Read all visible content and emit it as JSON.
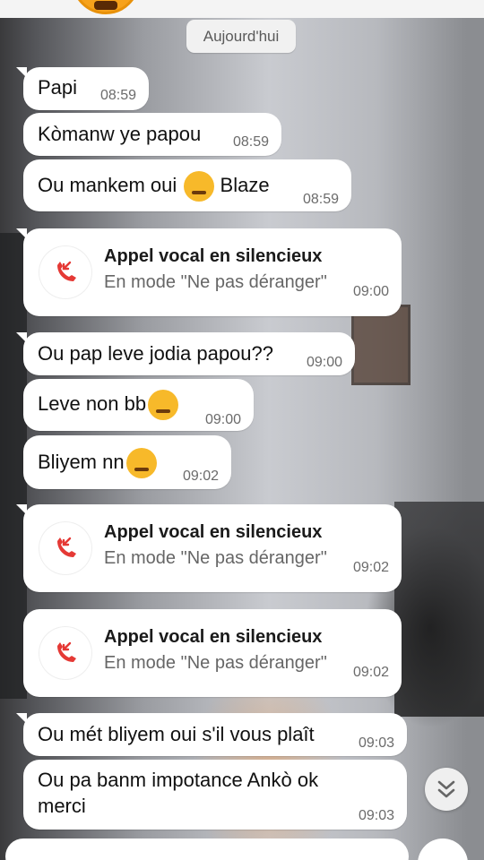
{
  "date_separator": "Aujourd'hui",
  "messages": [
    {
      "type": "text",
      "text": "Papi",
      "time": "08:59"
    },
    {
      "type": "text",
      "text": "Kòmanw ye papou",
      "time": "08:59"
    },
    {
      "type": "text",
      "text_before": "Ou mankem oui",
      "emoji": "pensive-face-emoji",
      "text_after": "Blaze",
      "time": "08:59"
    },
    {
      "type": "call",
      "title": "Appel vocal en silencieux",
      "subtitle": "En mode \"Ne pas déranger\"",
      "time": "09:00",
      "icon": "missed-call-icon"
    },
    {
      "type": "text",
      "text": "Ou pap leve jodia papou??",
      "time": "09:00"
    },
    {
      "type": "text",
      "text": "Leve non bb",
      "emoji": "weary-face-emoji",
      "time": "09:00"
    },
    {
      "type": "text",
      "text": "Bliyem nn",
      "emoji": "weary-face-emoji",
      "time": "09:02"
    },
    {
      "type": "call",
      "title": "Appel vocal en silencieux",
      "subtitle": "En mode \"Ne pas déranger\"",
      "time": "09:02",
      "icon": "missed-call-icon"
    },
    {
      "type": "call",
      "title": "Appel vocal en silencieux",
      "subtitle": "En mode \"Ne pas déranger\"",
      "time": "09:02",
      "icon": "missed-call-icon"
    },
    {
      "type": "text",
      "text": "Ou mét bliyem oui s'il vous plaît",
      "time": "09:03"
    },
    {
      "type": "text",
      "text_line1": "Ou pa banm impotance Ankò ok",
      "text_line2": "merci",
      "time": "09:03"
    }
  ],
  "icons": {
    "scroll_down": "double-chevron-down-icon",
    "missed_call": "missed-call-icon"
  },
  "colors": {
    "bubble": "#ffffff",
    "missed_call_red": "#e53935",
    "time_text": "#6b6b6b"
  }
}
